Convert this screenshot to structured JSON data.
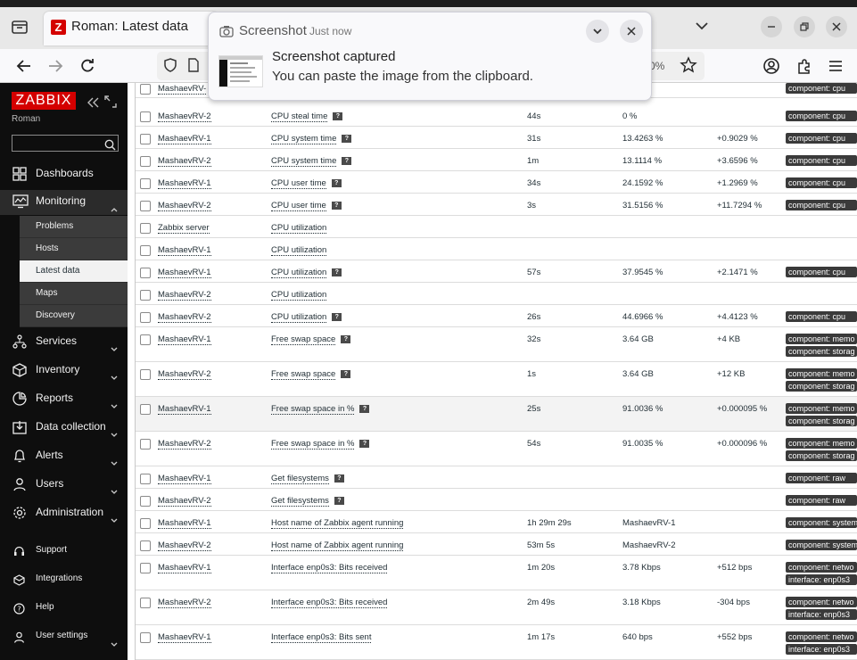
{
  "browser": {
    "tab_title": "Roman: Latest data",
    "tab_favicon": "Z",
    "zoom": "0%",
    "icons": [
      "tab-list-icon",
      "chevron-down-icon",
      "minimize-icon",
      "restore-icon",
      "close-icon",
      "back-icon",
      "forward-icon",
      "reload-icon",
      "shield-icon",
      "page-icon",
      "star-icon",
      "account-icon",
      "extensions-icon",
      "menu-icon"
    ]
  },
  "notification": {
    "app": "Screenshot",
    "time": "Just now",
    "title": "Screenshot captured",
    "body": "You can paste the image from the clipboard."
  },
  "sidebar": {
    "logo": "ZABBIX",
    "user": "Roman",
    "search_placeholder": "",
    "items": [
      {
        "label": "Dashboards",
        "icon": "dashboard-icon"
      },
      {
        "label": "Monitoring",
        "icon": "monitoring-icon"
      },
      {
        "label": "Services",
        "icon": "services-icon"
      },
      {
        "label": "Inventory",
        "icon": "inventory-icon"
      },
      {
        "label": "Reports",
        "icon": "reports-icon"
      },
      {
        "label": "Data collection",
        "icon": "data-collection-icon"
      },
      {
        "label": "Alerts",
        "icon": "bell-icon"
      },
      {
        "label": "Users",
        "icon": "users-icon"
      },
      {
        "label": "Administration",
        "icon": "gear-icon"
      }
    ],
    "monitoring_sub": [
      "Problems",
      "Hosts",
      "Latest data",
      "Maps",
      "Discovery"
    ],
    "bottom": [
      {
        "label": "Support",
        "icon": "headset-icon"
      },
      {
        "label": "Integrations",
        "icon": "integrations-icon"
      },
      {
        "label": "Help",
        "icon": "help-icon"
      },
      {
        "label": "User settings",
        "icon": "user-icon"
      }
    ]
  },
  "table": {
    "rows": [
      {
        "host": "MashaevRV-",
        "item": "",
        "info": false,
        "last": "",
        "value": "",
        "change": "",
        "tags": [
          "component: cpu"
        ]
      },
      {
        "host": "MashaevRV-2",
        "item": "CPU steal time",
        "info": true,
        "last": "44s",
        "value": "0 %",
        "change": "",
        "tags": [
          "component: cpu"
        ]
      },
      {
        "host": "MashaevRV-1",
        "item": "CPU system time",
        "info": true,
        "last": "31s",
        "value": "13.4263 %",
        "change": "+0.9029 %",
        "tags": [
          "component: cpu"
        ]
      },
      {
        "host": "MashaevRV-2",
        "item": "CPU system time",
        "info": true,
        "last": "1m",
        "value": "13.1114 %",
        "change": "+3.6596 %",
        "tags": [
          "component: cpu"
        ]
      },
      {
        "host": "MashaevRV-1",
        "item": "CPU user time",
        "info": true,
        "last": "34s",
        "value": "24.1592 %",
        "change": "+1.2969 %",
        "tags": [
          "component: cpu"
        ]
      },
      {
        "host": "MashaevRV-2",
        "item": "CPU user time",
        "info": true,
        "last": "3s",
        "value": "31.5156 %",
        "change": "+11.7294 %",
        "tags": [
          "component: cpu"
        ]
      },
      {
        "host": "Zabbix server",
        "item": "CPU utilization",
        "info": false,
        "last": "",
        "value": "",
        "change": "",
        "tags": []
      },
      {
        "host": "MashaevRV-1",
        "item": "CPU utilization",
        "info": false,
        "last": "",
        "value": "",
        "change": "",
        "tags": []
      },
      {
        "host": "MashaevRV-1",
        "item": "CPU utilization",
        "info": true,
        "last": "57s",
        "value": "37.9545 %",
        "change": "+2.1471 %",
        "tags": [
          "component: cpu"
        ]
      },
      {
        "host": "MashaevRV-2",
        "item": "CPU utilization",
        "info": false,
        "last": "",
        "value": "",
        "change": "",
        "tags": []
      },
      {
        "host": "MashaevRV-2",
        "item": "CPU utilization",
        "info": true,
        "last": "26s",
        "value": "44.6966 %",
        "change": "+4.4123 %",
        "tags": [
          "component: cpu"
        ]
      },
      {
        "host": "MashaevRV-1",
        "item": "Free swap space",
        "info": true,
        "last": "32s",
        "value": "3.64 GB",
        "change": "+4 KB",
        "tags": [
          "component: memo",
          "component: storag"
        ]
      },
      {
        "host": "MashaevRV-2",
        "item": "Free swap space",
        "info": true,
        "last": "1s",
        "value": "3.64 GB",
        "change": "+12 KB",
        "tags": [
          "component: memo",
          "component: storag"
        ]
      },
      {
        "host": "MashaevRV-1",
        "item": "Free swap space in %",
        "info": true,
        "last": "25s",
        "value": "91.0036 %",
        "change": "+0.000095 %",
        "tags": [
          "component: memo",
          "component: storag"
        ]
      },
      {
        "host": "MashaevRV-2",
        "item": "Free swap space in %",
        "info": true,
        "last": "54s",
        "value": "91.0035 %",
        "change": "+0.000096 %",
        "tags": [
          "component: memo",
          "component: storag"
        ]
      },
      {
        "host": "MashaevRV-1",
        "item": "Get filesystems",
        "info": true,
        "last": "",
        "value": "",
        "change": "",
        "tags": [
          "component: raw"
        ]
      },
      {
        "host": "MashaevRV-2",
        "item": "Get filesystems",
        "info": true,
        "last": "",
        "value": "",
        "change": "",
        "tags": [
          "component: raw"
        ]
      },
      {
        "host": "MashaevRV-1",
        "item": "Host name of Zabbix agent running",
        "info": false,
        "last": "1h 29m 29s",
        "value": "MashaevRV-1",
        "change": "",
        "tags": [
          "component: system"
        ]
      },
      {
        "host": "MashaevRV-2",
        "item": "Host name of Zabbix agent running",
        "info": false,
        "last": "53m 5s",
        "value": "MashaevRV-2",
        "change": "",
        "tags": [
          "component: system"
        ]
      },
      {
        "host": "MashaevRV-1",
        "item": "Interface enp0s3: Bits received",
        "info": false,
        "last": "1m 20s",
        "value": "3.78 Kbps",
        "change": "+512 bps",
        "tags": [
          "component: netwo",
          "interface: enp0s3"
        ]
      },
      {
        "host": "MashaevRV-2",
        "item": "Interface enp0s3: Bits received",
        "info": false,
        "last": "2m 49s",
        "value": "3.18 Kbps",
        "change": "-304 bps",
        "tags": [
          "component: netwo",
          "interface: enp0s3"
        ]
      },
      {
        "host": "MashaevRV-1",
        "item": "Interface enp0s3: Bits sent",
        "info": false,
        "last": "1m 17s",
        "value": "640 bps",
        "change": "+552 bps",
        "tags": [
          "component: netwo",
          "interface: enp0s3"
        ]
      }
    ]
  }
}
